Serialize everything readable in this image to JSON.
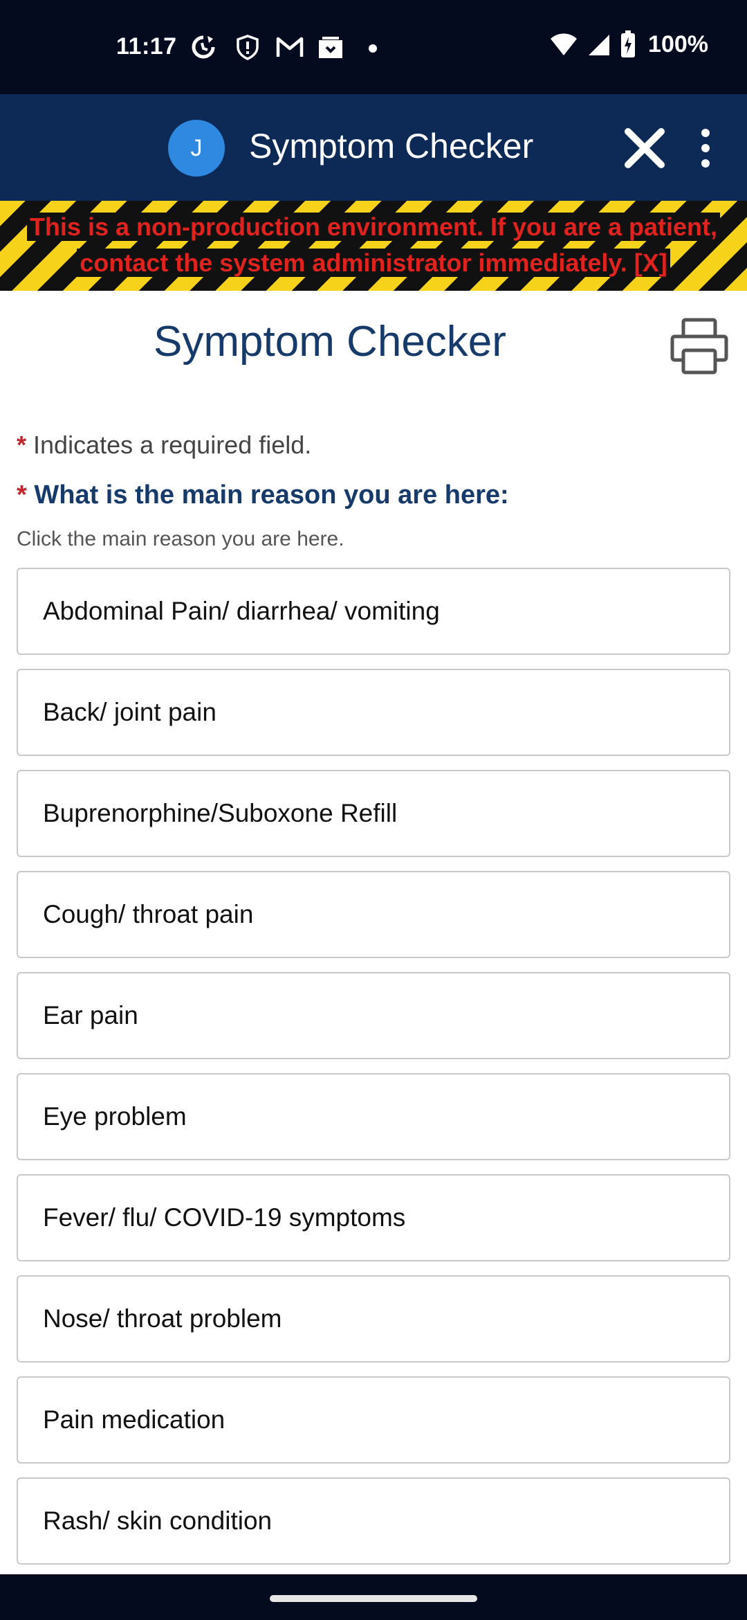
{
  "status_bar": {
    "time": "11:17",
    "battery": "100%",
    "icons": [
      "sync-icon",
      "shield-icon",
      "gmail-icon",
      "inbox-icon",
      "dot-icon",
      "wifi-icon",
      "signal-icon",
      "battery-icon"
    ]
  },
  "app_bar": {
    "avatar_initial": "J",
    "title": "Symptom Checker",
    "avatar_color": "#2f89e0",
    "background": "#0d2a57"
  },
  "warning": {
    "line1": "This is a non-production environment. If you are a patient,",
    "line2": "contact the system administrator immediately. [X]"
  },
  "page": {
    "title": "Symptom Checker",
    "required_star": "*",
    "required_note": "Indicates a required field.",
    "question": "What is the main reason you are here:",
    "hint": "Click the main reason you are here."
  },
  "options": [
    "Abdominal Pain/ diarrhea/ vomiting",
    "Back/ joint pain",
    "Buprenorphine/Suboxone Refill",
    "Cough/ throat pain",
    "Ear pain",
    "Eye problem",
    "Fever/ flu/ COVID-19 symptoms",
    "Nose/ throat problem",
    "Pain medication",
    "Rash/ skin condition"
  ]
}
